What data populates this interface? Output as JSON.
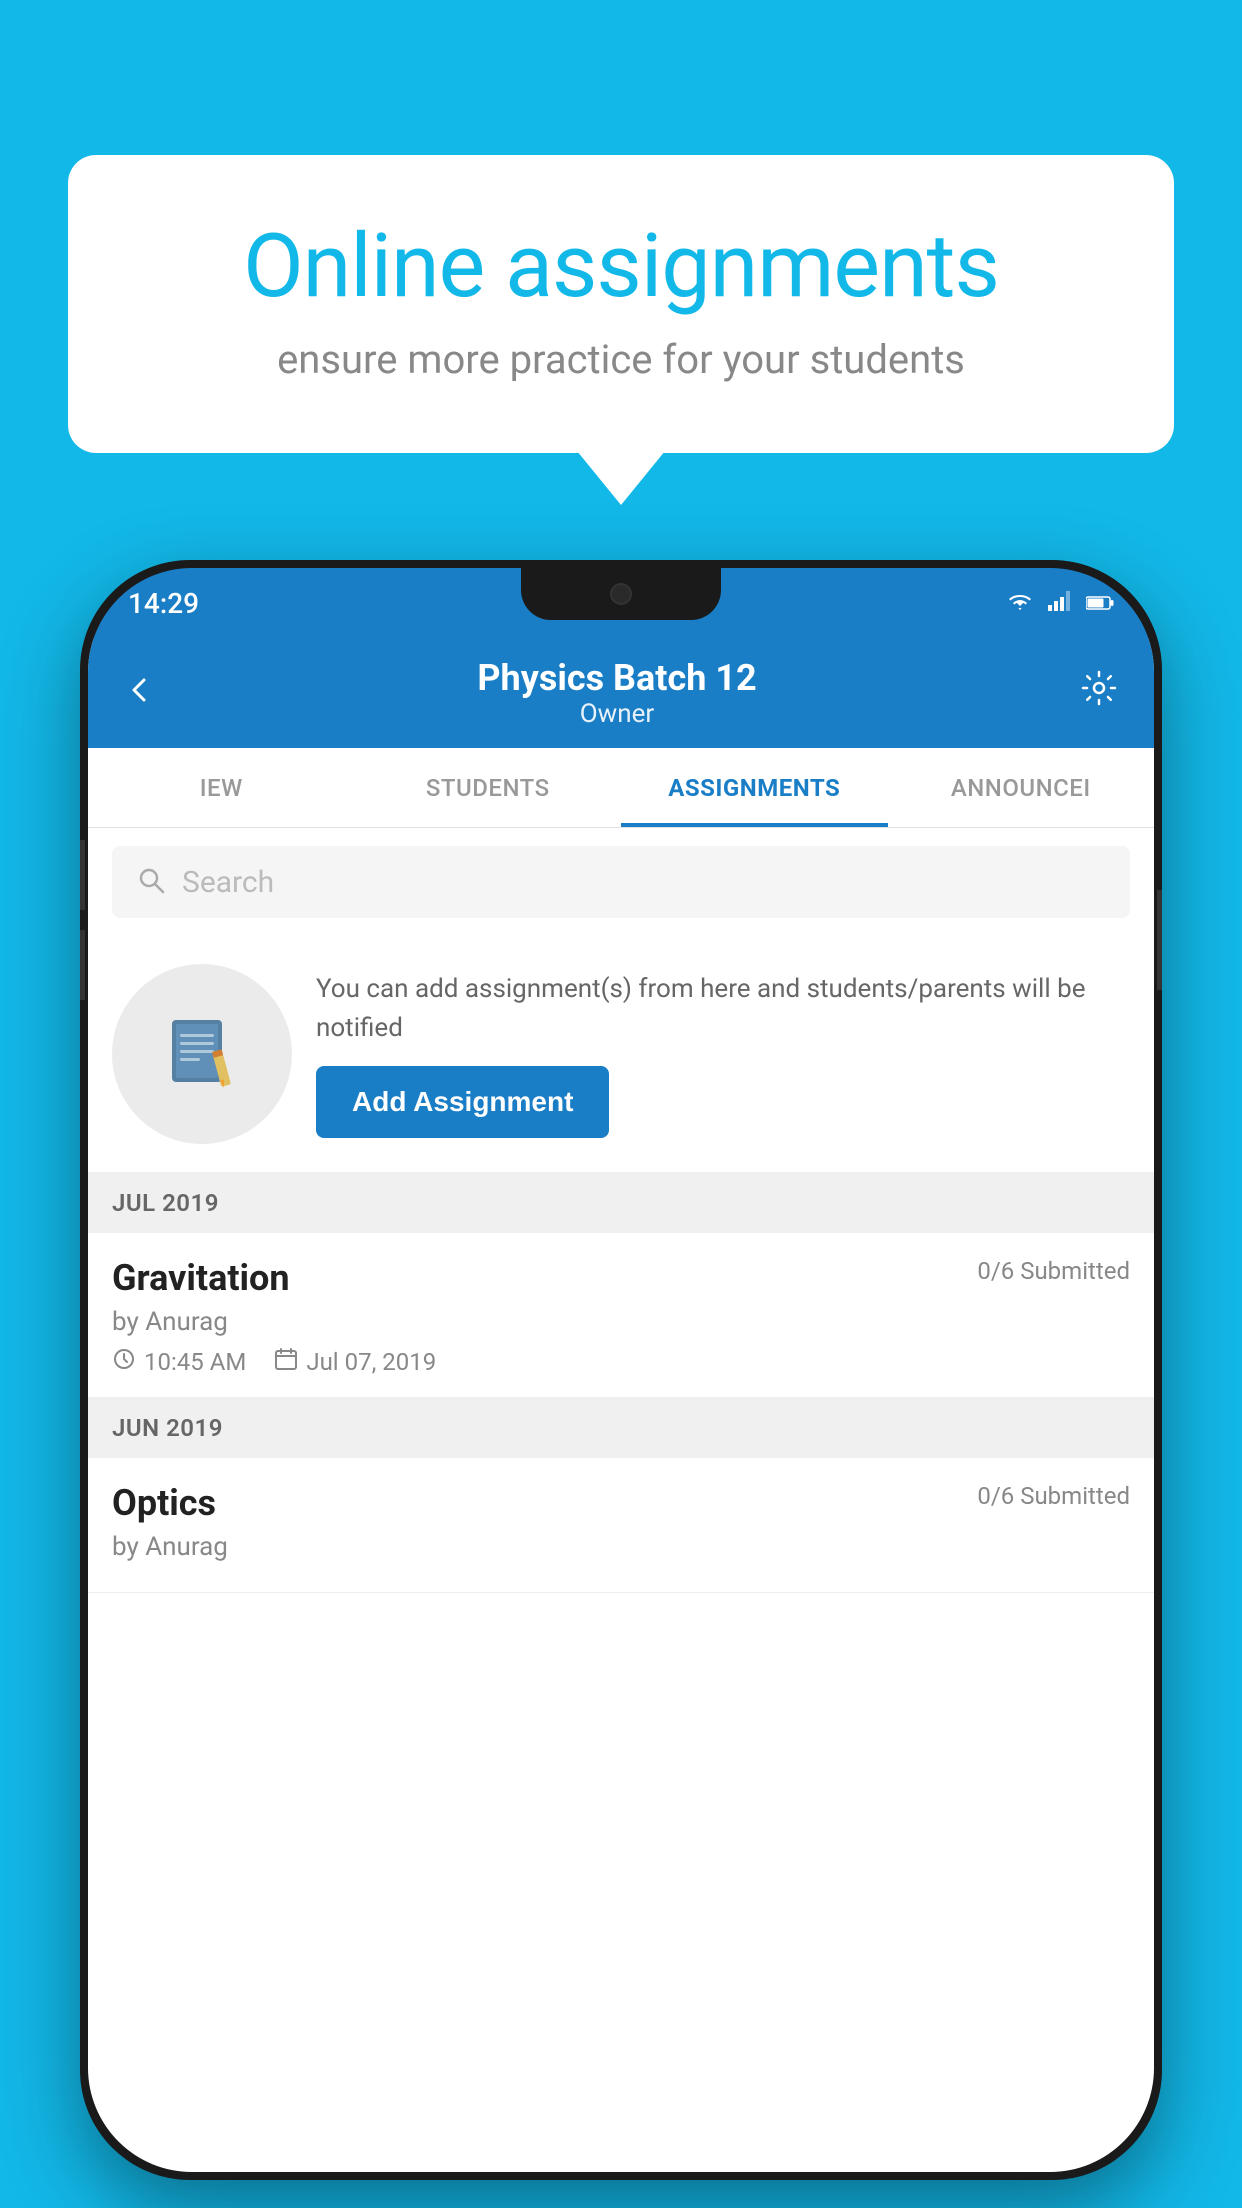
{
  "background_color": "#12b8e8",
  "speech_bubble": {
    "title": "Online assignments",
    "subtitle": "ensure more practice for your students"
  },
  "phone": {
    "status_bar": {
      "time": "14:29"
    },
    "header": {
      "title": "Physics Batch 12",
      "subtitle": "Owner",
      "back_label": "←",
      "settings_label": "⚙"
    },
    "tabs": [
      {
        "label": "IEW",
        "active": false
      },
      {
        "label": "STUDENTS",
        "active": false
      },
      {
        "label": "ASSIGNMENTS",
        "active": true
      },
      {
        "label": "ANNOUNCEI",
        "active": false
      }
    ],
    "search": {
      "placeholder": "Search"
    },
    "promo": {
      "text": "You can add assignment(s) from here and students/parents will be notified",
      "button_label": "Add Assignment"
    },
    "sections": [
      {
        "header": "JUL 2019",
        "assignments": [
          {
            "title": "Gravitation",
            "submitted": "0/6 Submitted",
            "author": "by Anurag",
            "time": "10:45 AM",
            "date": "Jul 07, 2019"
          }
        ]
      },
      {
        "header": "JUN 2019",
        "assignments": [
          {
            "title": "Optics",
            "submitted": "0/6 Submitted",
            "author": "by Anurag",
            "time": "",
            "date": ""
          }
        ]
      }
    ]
  }
}
